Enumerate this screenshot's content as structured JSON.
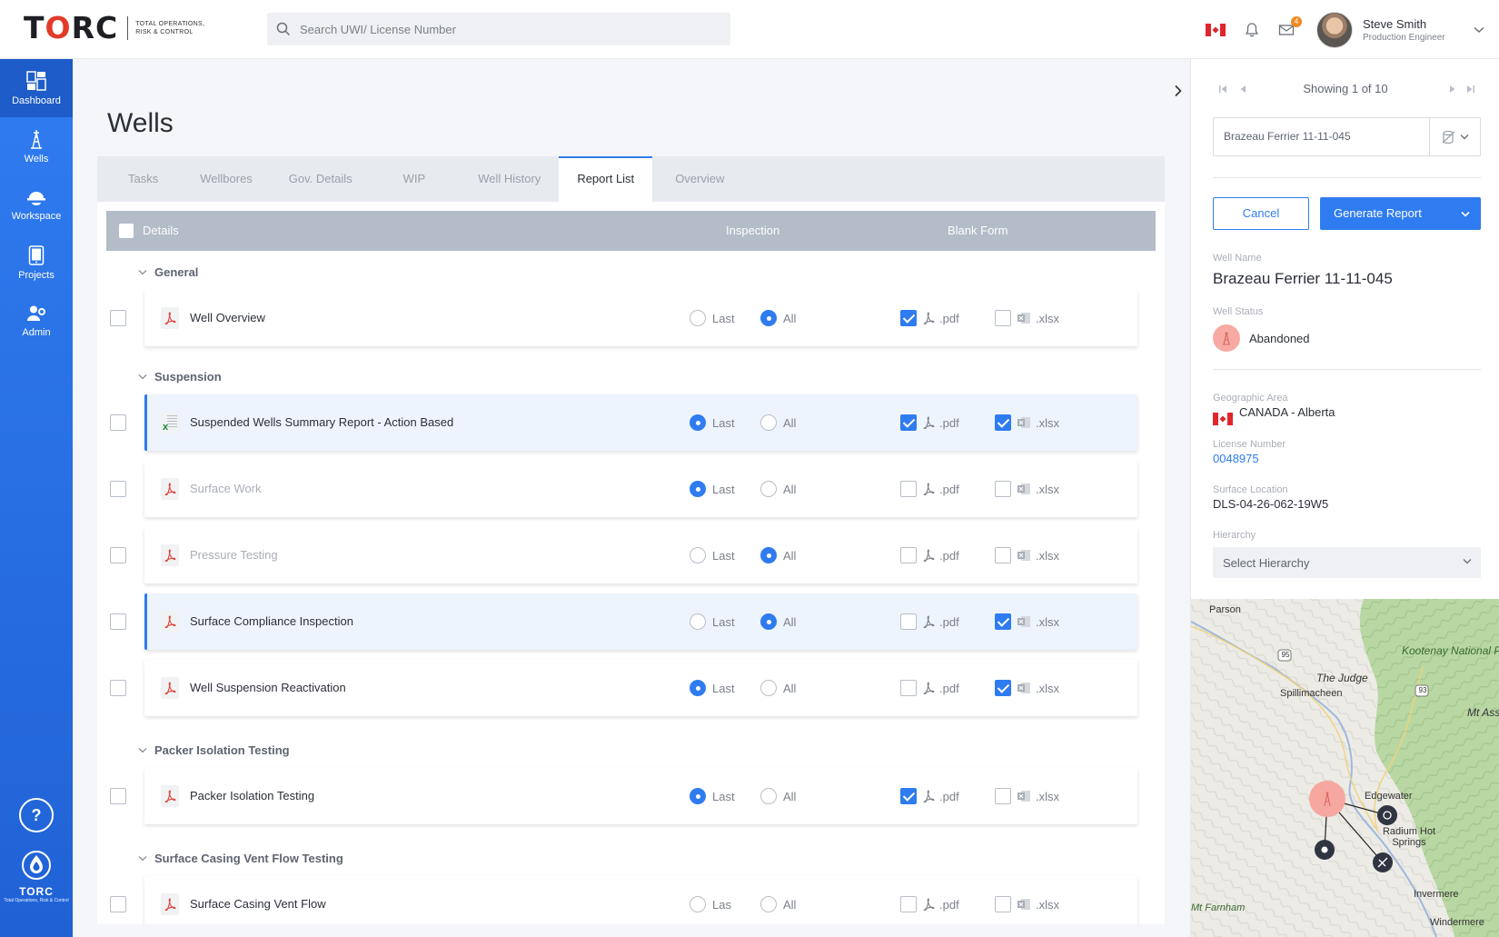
{
  "header": {
    "logo_text": "TORC",
    "logo_tagline": "Total Operations, Risk & Control",
    "search_placeholder": "Search UWI/ License Number",
    "mail_badge": "4",
    "user_name": "Steve Smith",
    "user_role": "Production Engineer"
  },
  "sidebar": {
    "items": [
      {
        "label": "Dashboard",
        "icon": "dashboard-icon"
      },
      {
        "label": "Wells",
        "icon": "oil-rig-icon"
      },
      {
        "label": "Workspace",
        "icon": "hard-hat-icon"
      },
      {
        "label": "Projects",
        "icon": "tablet-icon"
      },
      {
        "label": "Admin",
        "icon": "user-gear-icon"
      }
    ],
    "help_label": "?",
    "footer_logo": "TORC",
    "footer_tagline": "Total Operations, Risk & Control"
  },
  "page": {
    "title": "Wells",
    "tabs": [
      "Tasks",
      "Wellbores",
      "Gov. Details",
      "WIP",
      "Well History",
      "Report List",
      "Overview"
    ],
    "active_tab": "Report List"
  },
  "table": {
    "headers": {
      "details": "Details",
      "inspection": "Inspection",
      "blank_form": "Blank Form"
    },
    "option_last": "Last",
    "option_all": "All",
    "format_pdf": ".pdf",
    "format_xlsx": ".xlsx",
    "categories": [
      "General",
      "Suspension",
      "Packer Isolation Testing",
      "Surface Casing Vent Flow Testing"
    ],
    "rows": [
      {
        "name": "Well Overview",
        "inspection": "All",
        "pdf": true,
        "xlsx": false,
        "file": "pdf",
        "muted": false,
        "highlight": false
      },
      {
        "name": "Suspended Wells Summary Report - Action Based",
        "inspection": "Last",
        "pdf": true,
        "xlsx": true,
        "file": "xlsx",
        "muted": false,
        "highlight": true
      },
      {
        "name": "Surface Work",
        "inspection": "Last",
        "pdf": false,
        "xlsx": false,
        "file": "pdf",
        "muted": true,
        "highlight": false
      },
      {
        "name": "Pressure Testing",
        "inspection": "All",
        "pdf": false,
        "xlsx": false,
        "file": "pdf",
        "muted": true,
        "highlight": false
      },
      {
        "name": "Surface Compliance Inspection",
        "inspection": "All",
        "pdf": false,
        "xlsx": true,
        "file": "pdf",
        "muted": false,
        "highlight": true
      },
      {
        "name": "Well Suspension Reactivation",
        "inspection": "Last",
        "pdf": false,
        "xlsx": true,
        "file": "pdf",
        "muted": false,
        "highlight": false
      },
      {
        "name": "Packer Isolation Testing",
        "inspection": "Last",
        "pdf": true,
        "xlsx": false,
        "file": "pdf",
        "muted": false,
        "highlight": false
      },
      {
        "name": "Surface Casing Vent Flow",
        "inspection": "",
        "pdf": false,
        "xlsx": false,
        "file": "pdf",
        "muted": false,
        "highlight": false
      }
    ],
    "partial_last": "Las"
  },
  "details_panel": {
    "pager_text": "Showing 1 of 10",
    "well_select_value": "Brazeau Ferrier 11-11-045",
    "cancel_label": "Cancel",
    "generate_label": "Generate Report",
    "well_name_label": "Well Name",
    "well_name": "Brazeau Ferrier 11-11-045",
    "well_status_label": "Well Status",
    "well_status": "Abandoned",
    "geo_label": "Geographic Area",
    "geo_value": "CANADA - Alberta",
    "license_label": "License Number",
    "license_value": "0048975",
    "surface_label": "Surface Location",
    "surface_value": "DLS-04-26-062-19W5",
    "hierarchy_label": "Hierarchy",
    "hierarchy_placeholder": "Select Hierarchy",
    "status_color": "#f7aaa3",
    "accent_color": "#2f7cf0"
  },
  "map": {
    "labels": [
      "Parson",
      "The Judge",
      "Spillimacheen",
      "Kootenay National Park",
      "Mt Ass",
      "Edgewater",
      "Radium Hot Springs",
      "Mt Farnham",
      "Invermere",
      "Windermere"
    ],
    "shields": [
      "95",
      "93"
    ]
  }
}
